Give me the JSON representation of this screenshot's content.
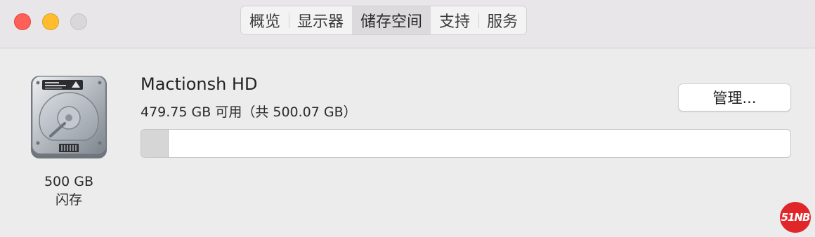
{
  "window": {
    "controls": [
      "close",
      "minimize",
      "zoom"
    ]
  },
  "tabs": [
    {
      "label": "概览",
      "active": false
    },
    {
      "label": "显示器",
      "active": false
    },
    {
      "label": "储存空间",
      "active": true
    },
    {
      "label": "支持",
      "active": false
    },
    {
      "label": "服务",
      "active": false
    }
  ],
  "drive": {
    "name": "Mactionsh HD",
    "available": "479.75 GB 可用（共 500.07 GB）",
    "capacity_label": "500 GB",
    "type_label": "闪存",
    "used_fraction": 0.0406,
    "icon": "hard-drive-icon"
  },
  "actions": {
    "manage_label": "管理..."
  },
  "watermark": {
    "text": "51NB",
    "color": "#e1262a"
  }
}
